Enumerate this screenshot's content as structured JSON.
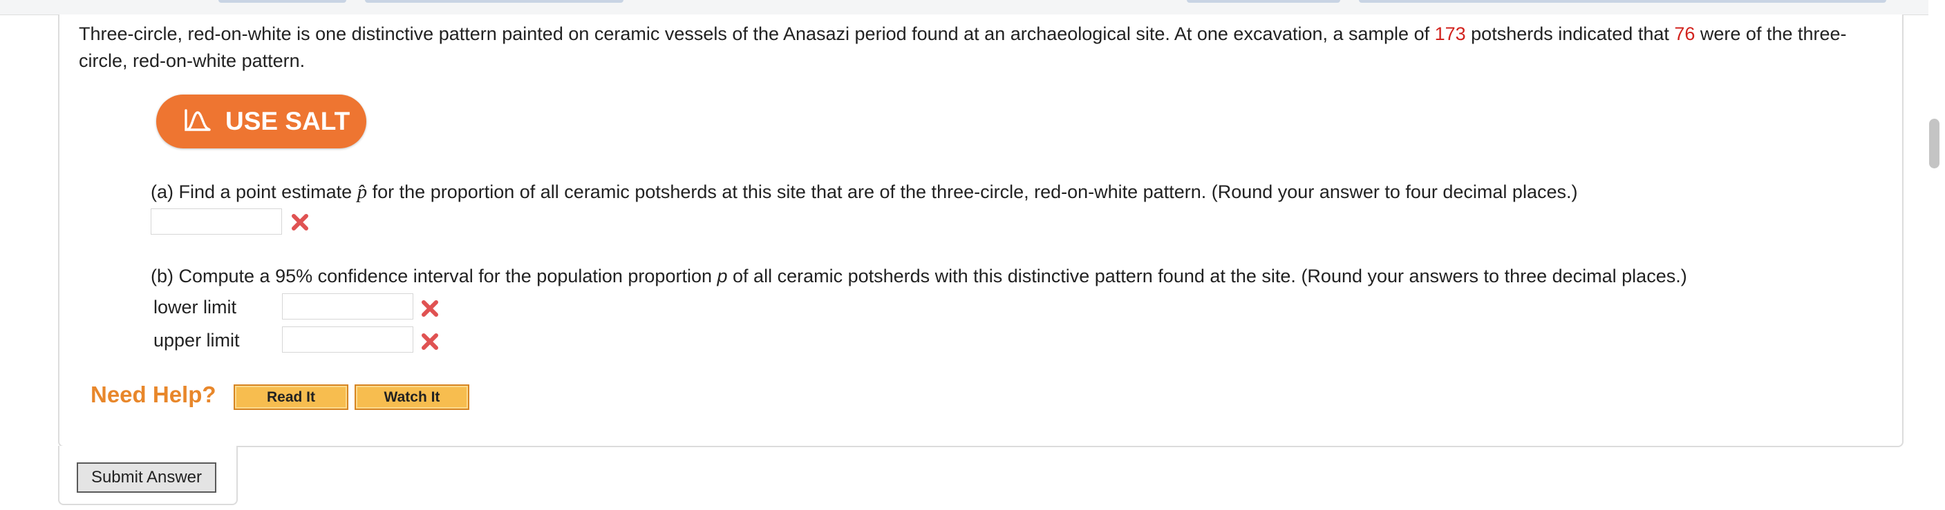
{
  "question": {
    "text_before": "Three-circle, red-on-white is one distinctive pattern painted on ceramic vessels of the Anasazi period found at an archaeological site. At one excavation, a sample of ",
    "sample_size": "173",
    "text_middle": " potsherds indicated that ",
    "count": "76",
    "text_after": " were of the three-circle, red-on-white pattern."
  },
  "salt_button": {
    "label": "USE SALT",
    "icon": "distribution-curve-icon"
  },
  "part_a": {
    "prefix": "(a) Find a point estimate ",
    "symbol": "p̂",
    "suffix": " for the proportion of all ceramic potsherds at this site that are of the three-circle, red-on-white pattern. (Round your answer to four decimal places.)",
    "answer": "",
    "status": "incorrect"
  },
  "part_b": {
    "prefix": "(b) Compute a 95% confidence interval for the population proportion ",
    "symbol": "p",
    "suffix": " of all ceramic potsherds with this distinctive pattern found at the site. (Round your answers to three decimal places.)",
    "lower_label": "lower limit",
    "upper_label": "upper limit",
    "lower_answer": "",
    "upper_answer": "",
    "status": "incorrect"
  },
  "help": {
    "label": "Need Help?",
    "read_it": "Read It",
    "watch_it": "Watch It"
  },
  "submit_label": "Submit Answer",
  "colors": {
    "highlight_red": "#d2231e",
    "salt_orange": "#ee7531",
    "help_orange": "#e8872b",
    "help_button_fill": "#f7bd4f",
    "incorrect_mark": "#e05252"
  }
}
